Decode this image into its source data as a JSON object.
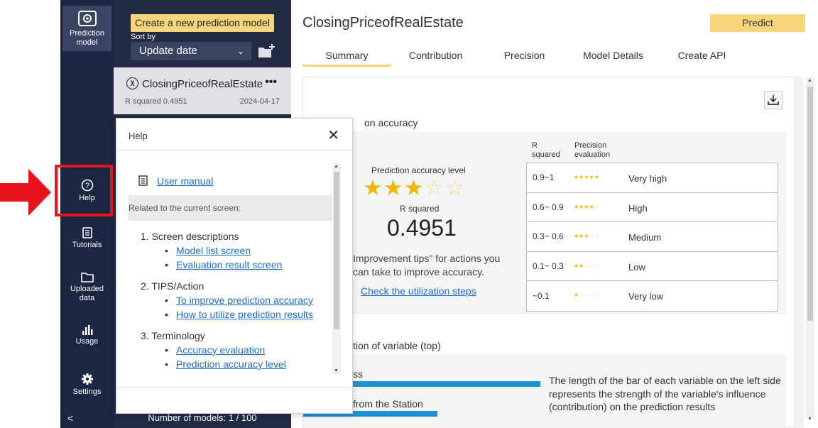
{
  "nav": {
    "items": [
      {
        "label": "Prediction model",
        "icon": "prediction-model-icon"
      },
      {
        "label": "Help",
        "icon": "help-icon"
      },
      {
        "label": "Tutorials",
        "icon": "tutorials-icon"
      },
      {
        "label": "Uploaded data",
        "icon": "folder-icon"
      },
      {
        "label": "Usage",
        "icon": "usage-chart-icon"
      },
      {
        "label": "Settings",
        "icon": "gear-icon"
      }
    ],
    "collapse_label": "<"
  },
  "model_list": {
    "create_label": "Create a new prediction model",
    "sort_label": "Sort by",
    "sort_value": "Update date",
    "model": {
      "name": "ClosingPriceofRealEstate",
      "icon_glyph": "χ",
      "r_squared": "R squared 0.4951",
      "date": "2024-04-17",
      "more": "•••"
    },
    "count": "Number of models: 1 / 100"
  },
  "main": {
    "title": "ClosingPriceofRealEstate",
    "predict_label": "Predict",
    "tabs": [
      "Summary",
      "Contribution",
      "Precision",
      "Model Details",
      "Create API"
    ],
    "active_tab": "Summary",
    "section1_title": "on accuracy",
    "accuracy_level_label": "Prediction accuracy level",
    "stars_filled": 3,
    "stars_total": 5,
    "r_squared_label": "R squared",
    "r_squared_value": "0.4951",
    "tips_line1": "Improvement tips\" for actions you",
    "tips_line2": "can take to improve accuracy.",
    "check_link": "Check the utilization steps",
    "table_header_r": "R\nsquared",
    "table_header_r_line1": "R",
    "table_header_r_line2": "squared",
    "table_header_p_line1": "Precision",
    "table_header_p_line2": "evaluation",
    "precision_rows": [
      {
        "range": "0.9~1",
        "stars": 5,
        "label": "Very high"
      },
      {
        "range": "0.6~ 0.9",
        "stars": 4,
        "label": "High"
      },
      {
        "range": "0.3~ 0.6",
        "stars": 3,
        "label": "Medium"
      },
      {
        "range": "0.1~ 0.3",
        "stars": 2,
        "label": "Low"
      },
      {
        "range": "~0.1",
        "stars": 1,
        "label": "Very low"
      }
    ],
    "section2_title": "tion of variable (top)",
    "bar1_label": "ss",
    "bar2_label": "from the Station",
    "contribution_note": "The length of the bar of each variable on the left side represents the strength of the variable's influence (contribution) on the prediction results"
  },
  "help": {
    "title": "Help",
    "close": "✕",
    "manual_link": "User manual",
    "related_label": "Related to the current screen:",
    "sections": [
      {
        "title": "1. Screen descriptions",
        "links": [
          "Model list screen",
          "Evaluation result screen"
        ]
      },
      {
        "title": "2. TIPS/Action",
        "links": [
          "To improve prediction accuracy",
          "How to utilize prediction results"
        ]
      },
      {
        "title": "3. Terminology",
        "links": [
          "Accuracy evaluation",
          "Prediction accuracy level"
        ]
      }
    ]
  },
  "colors": {
    "nav_bg": "#1c2541",
    "list_bg": "#232b44",
    "accent_yellow": "#f7d57a",
    "link_blue": "#1f6fc5",
    "bar_blue": "#1e90d8",
    "annotation_red": "#e8141b",
    "star_gold": "#f2b705"
  }
}
